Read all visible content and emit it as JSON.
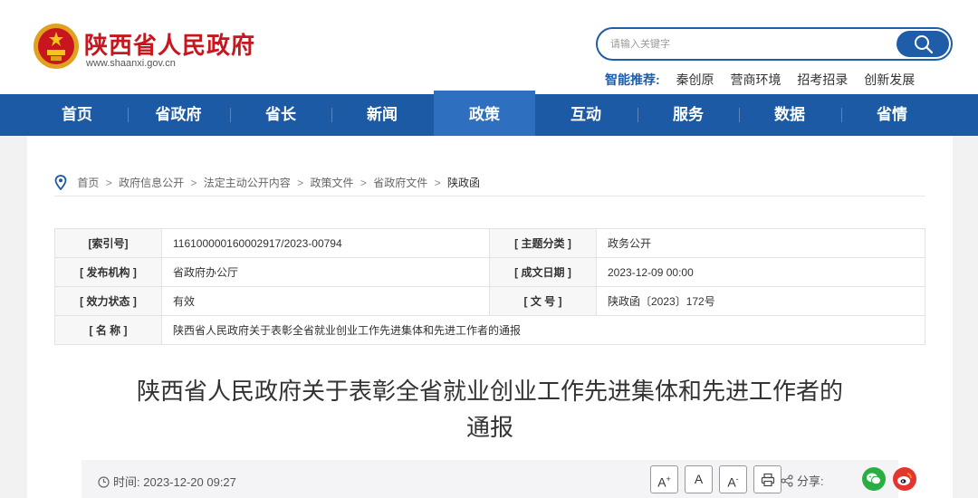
{
  "header": {
    "site_title": "陕西省人民政府",
    "site_url": "www.shaanxi.gov.cn",
    "search_placeholder": "请输入关键字",
    "recommend_label": "智能推荐:",
    "recommend_items": [
      "秦创原",
      "营商环境",
      "招考招录",
      "创新发展"
    ]
  },
  "nav": {
    "items": [
      "首页",
      "省政府",
      "省长",
      "新闻",
      "政策",
      "互动",
      "服务",
      "数据",
      "省情"
    ],
    "active": "政策",
    "colors": {
      "bar": "#1c5aa5",
      "active": "#2e6fbf",
      "brand_red": "#c7161e"
    }
  },
  "breadcrumb": {
    "items": [
      "首页",
      "政府信息公开",
      "法定主动公开内容",
      "政策文件",
      "省政府文件",
      "陕政函"
    ],
    "separator": ">"
  },
  "meta": {
    "index_label": "[索引号]",
    "index_value": "116100000160002917/2023-00794",
    "topic_label": "[ 主题分类 ]",
    "topic_value": "政务公开",
    "publisher_label": "[ 发布机构 ]",
    "publisher_value": "省政府办公厅",
    "date_label": "[ 成文日期 ]",
    "date_value": "2023-12-09 00:00",
    "status_label": "[ 效力状态 ]",
    "status_value": "有效",
    "docno_label": "[ 文 号 ]",
    "docno_value": "陕政函〔2023〕172号",
    "name_label": "[ 名 称 ]",
    "name_value": "陕西省人民政府关于表彰全省就业创业工作先进集体和先进工作者的通报"
  },
  "document": {
    "title_line1": "陕西省人民政府关于表彰全省就业创业工作先进集体和先进工作者的",
    "title_line2": "通报",
    "time_label": "时间:",
    "time_value": "2023-12-20 09:27",
    "font_large": "A",
    "font_medium": "A",
    "font_small": "A",
    "share_label": "分享:",
    "icons": [
      "clock-icon",
      "print-icon",
      "share-icon",
      "wechat-icon",
      "weibo-icon",
      "search-icon",
      "location-pin-icon",
      "national-emblem-icon"
    ]
  }
}
